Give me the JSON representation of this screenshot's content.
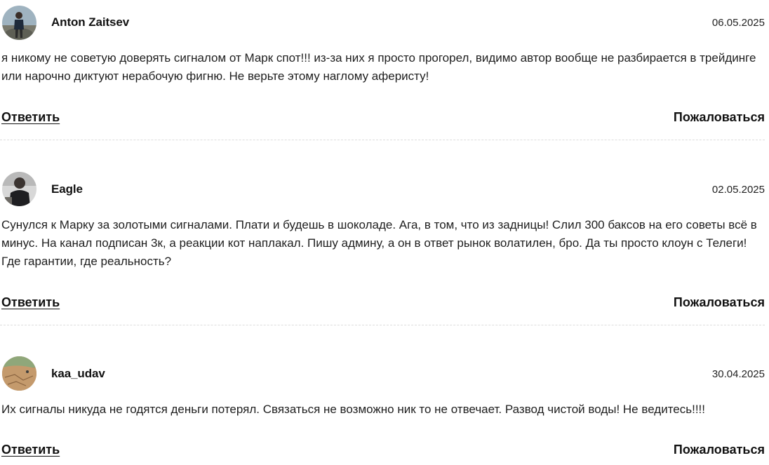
{
  "comments": [
    {
      "author": "Anton Zaitsev",
      "date": "06.05.2025",
      "text": "я никому не советую доверять сигналом от Марк спот!!! из-за них я просто прогорел, видимо автор вообще не разбирается в трейдинге или нарочно диктуют нерабочую фигню. Не верьте этому наглому аферисту!",
      "avatar_icon": "user-photo-outdoor-icon",
      "reply_label": "Ответить",
      "report_label": "Пожаловаться"
    },
    {
      "author": "Eagle",
      "date": "02.05.2025",
      "text": "Сунулся к Марку за золотыми сигналами. Плати и будешь в шоколаде. Ага, в том, что из задницы! Слил 300 баксов на его советы всё в минус. На канал подписан 3к, а реакции кот наплакал. Пишу админу, а он в ответ рынок волатилен, бро. Да ты просто клоун с Телеги! Где гарантии, где реальность?",
      "avatar_icon": "user-photo-dark-icon",
      "reply_label": "Ответить",
      "report_label": "Пожаловаться"
    },
    {
      "author": "kaa_udav",
      "date": "30.04.2025",
      "text": "Их сигналы никуда не годятся деньги потерял. Связаться не возможно ник то не отвечает. Развод чистой воды! Не ведитесь!!!!",
      "avatar_icon": "user-photo-desert-icon",
      "reply_label": "Ответить",
      "report_label": "Пожаловаться"
    }
  ],
  "colors": {
    "text": "#1e1e1e",
    "divider": "#dcdcdc",
    "background": "#ffffff"
  }
}
